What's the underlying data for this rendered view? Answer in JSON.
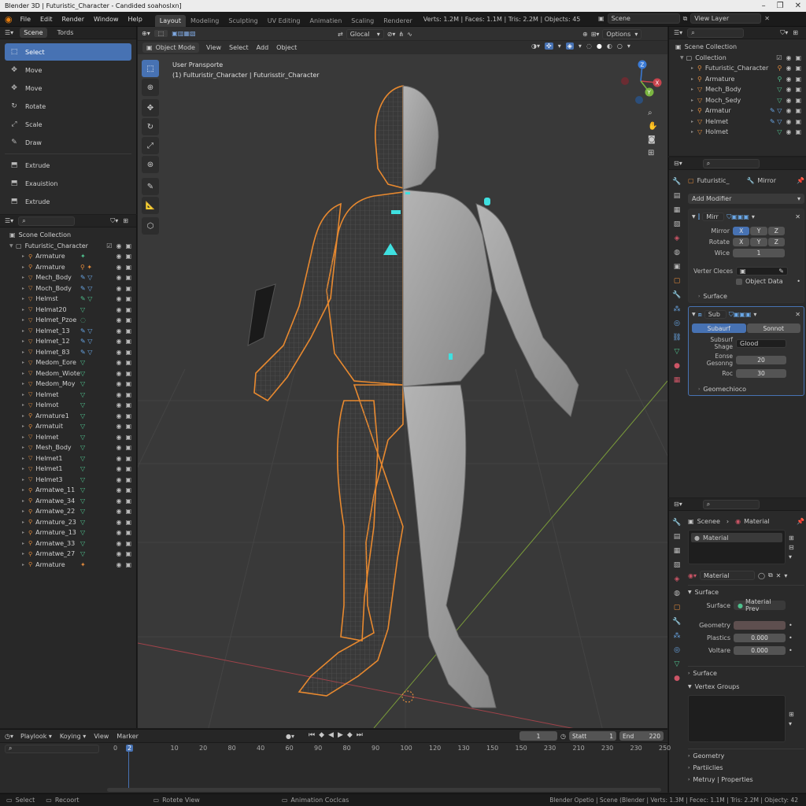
{
  "window": {
    "title": "Blender 3D | Futuristic_Character - Candided soahoslxn]"
  },
  "menu": [
    "File",
    "Edit",
    "Render",
    "Window",
    "Help"
  ],
  "workspaces": [
    "Layout",
    "Modeling",
    "Sculpting",
    "UV Editing",
    "Animatien",
    "Scaling",
    "Renderer"
  ],
  "stats": "Verts: 1.2M | Faces: 1.1M | Tris: 2.2M | Objects: 45",
  "scene_field": "Scene",
  "view_layer": "View Layer",
  "tool_panel": {
    "tabs": [
      "Scene",
      "Tords"
    ],
    "tools": [
      {
        "label": "Select",
        "icon": "select-icon"
      },
      {
        "label": "Move",
        "icon": "move-icon"
      },
      {
        "label": "Move",
        "icon": "move-icon"
      },
      {
        "label": "Rotate",
        "icon": "rotate-icon"
      },
      {
        "label": "Scale",
        "icon": "scale-icon"
      },
      {
        "label": "Draw",
        "icon": "draw-icon"
      },
      {
        "label": "Extrude",
        "icon": "extrude-icon"
      },
      {
        "label": "Exauistion",
        "icon": "extrude-icon"
      },
      {
        "label": "Extrude",
        "icon": "extrude-icon"
      }
    ],
    "active_index": 0
  },
  "outliner": {
    "root": "Scone Collection",
    "collection": "Futuristic_Character",
    "items": [
      "Armature",
      "Armature",
      "Mech_Body",
      "Moch_Body",
      "Helmst",
      "Helmat20",
      "Helmet_Pzoe",
      "Helmet_13",
      "Helmet_12",
      "Helmet_83",
      "Medom_Eore",
      "Medom_Wiote",
      "Medom_Moy",
      "Helmet",
      "Helmot",
      "Armature1",
      "Armatuit",
      "Helmet",
      "Mesh_Body",
      "Helmet1",
      "Helmet1",
      "Helmet3",
      "Armatwe_11",
      "Armatwe_34",
      "Armatwe_22",
      "Armature_23",
      "Armature_13",
      "Armatwe_33",
      "Armatwe_27",
      "Armature"
    ]
  },
  "viewport": {
    "pivot": "Glocal",
    "options_label": "Options",
    "mode": "Object Mode",
    "header_menu": [
      "View",
      "Select",
      "Add",
      "Object"
    ],
    "overlay_line1": "User Pransporte",
    "overlay_line2": "(1) Fulturistir_Character | Futurisstir_Character",
    "axes": {
      "x": "X",
      "y": "Y",
      "z": "Z"
    }
  },
  "outliner_right": {
    "root": "Scene Collection",
    "collection": "Collection",
    "items": [
      "Futuristic_Character",
      "Armature",
      "Mech_Body",
      "Moch_Sedy",
      "Armatur",
      "Helmet",
      "Holmet"
    ]
  },
  "modifiers": {
    "object_name": "Futuristic_",
    "modifier_name": "Mirror",
    "add_modifier": "Add Modifier",
    "mirror": {
      "short_name": "Mirr",
      "mirror_label": "Mirror",
      "rotate_label": "Rotate",
      "wice_label": "Wice",
      "wice_value": "1",
      "axis": [
        "X",
        "Y",
        "Z"
      ],
      "vertex_label": "Verter Cleces",
      "object_data": "Object Data",
      "surface": "Surface"
    },
    "subsurf": {
      "short_name": "Sub",
      "tab1": "Subaurf",
      "tab2": "Sonnot",
      "shape_label": "Subsurf Shage",
      "shape_value": "Glood",
      "geometry_label": "Eonse Gesonng",
      "geometry_value": "20",
      "roc_label": "Roc",
      "roc_value": "30",
      "geometry_panel": "Geomechioco"
    }
  },
  "material_panel": {
    "breadcrumb_scene": "Scenee",
    "breadcrumb_material": "Material",
    "slot": "Material",
    "material_name": "Material",
    "surface_header": "Surface",
    "surface_label": "Surface",
    "surface_value": "Material Prev",
    "geometry_label": "Geometry",
    "plastics_label": "Plastics",
    "plastics_value": "0.000",
    "voltare_label": "Voltare",
    "voltare_value": "0.000",
    "surface2": "Surface",
    "vertex_groups": "Vertex Groups",
    "geometry2": "Geometry",
    "particles": "Partiiclies",
    "more": "Metruy | Properties"
  },
  "timeline": {
    "menus": [
      "Playlook",
      "Koying",
      "View",
      "Marker"
    ],
    "current_frame": "1",
    "start_label": "Statt",
    "start_value": "1",
    "end_label": "End",
    "end_value": "220",
    "ticks": [
      "0",
      "2",
      "10",
      "20",
      "80",
      "40",
      "60",
      "90",
      "80",
      "90",
      "100",
      "120",
      "130",
      "150",
      "150",
      "230",
      "210",
      "230",
      "230",
      "250"
    ]
  },
  "status": {
    "select": "Select",
    "recoort": "Recoort",
    "rotate_view": "Rotete View",
    "animation": "Animation Coclcas",
    "info": "Blender Opetio | Scene (Blender | Verts: 1.3M | Fecec: 1.1M | Tris: 2.2M | Objecty: 42"
  }
}
